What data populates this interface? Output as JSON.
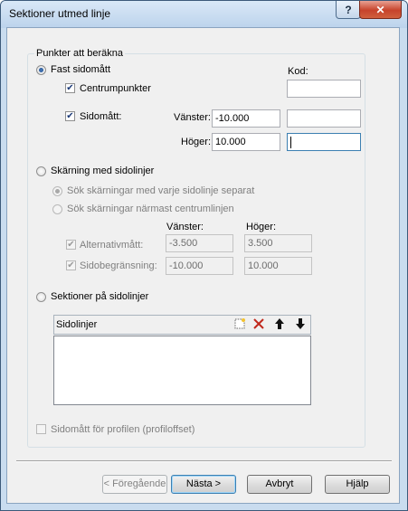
{
  "window": {
    "title": "Sektioner utmed linje",
    "help_glyph": "?",
    "close_glyph": "✕"
  },
  "group": {
    "label": "Punkter att beräkna"
  },
  "fast": {
    "label": "Fast sidomått",
    "kod_label": "Kod:",
    "centrum_label": "Centrumpunkter",
    "sidomatt_label": "Sidomått:",
    "vanster_label": "Vänster:",
    "vanster_value": "-10.000",
    "hoger_label": "Höger:",
    "hoger_value": "10.000",
    "kod_centrum_value": "",
    "kod_vanster_value": "",
    "kod_hoger_value": ""
  },
  "skarning": {
    "label": "Skärning med sidolinjer",
    "opt1": "Sök skärningar med varje sidolinje separat",
    "opt2": "Sök skärningar närmast centrumlinjen",
    "col_vanster": "Vänster:",
    "col_hoger": "Höger:",
    "alt_label": "Alternativmått:",
    "alt_vanster": "-3.500",
    "alt_hoger": "3.500",
    "begr_label": "Sidobegränsning:",
    "begr_vanster": "-10.000",
    "begr_hoger": "10.000"
  },
  "sektioner": {
    "label": "Sektioner på sidolinjer",
    "list_header": "Sidolinjer"
  },
  "profil": {
    "label": "Sidomått för profilen (profiloffset)"
  },
  "buttons": {
    "prev": "< Föregående",
    "next": "Nästa >",
    "cancel": "Avbryt",
    "help": "Hjälp"
  },
  "colors": {
    "accent": "#1c4f93",
    "titlebar": "#c9dcef",
    "close": "#c7432b"
  }
}
